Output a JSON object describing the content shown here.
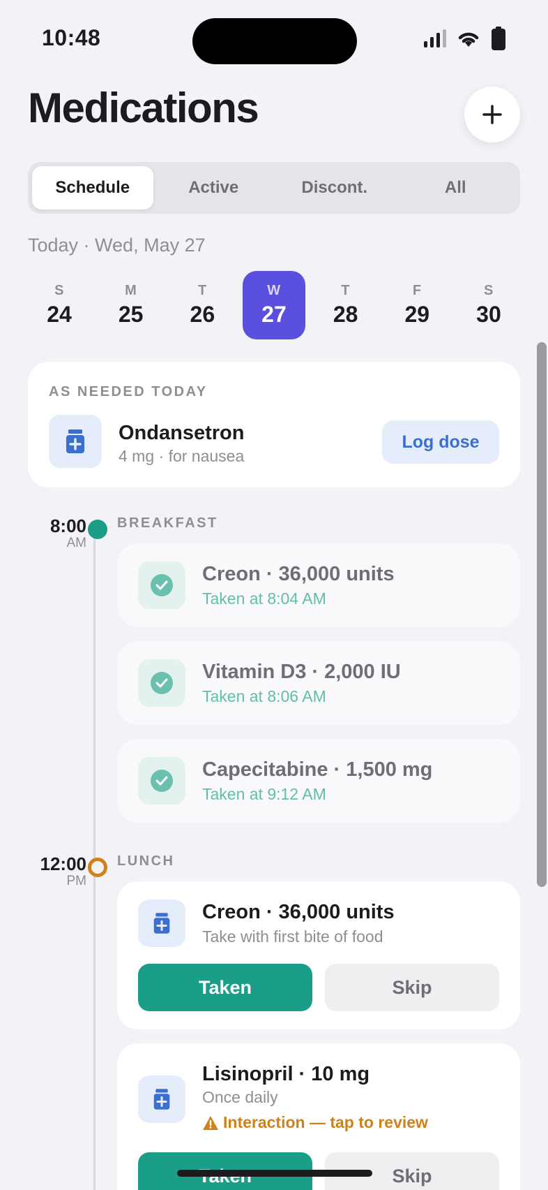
{
  "status_bar": {
    "time": "10:48"
  },
  "header": {
    "title": "Medications",
    "add_icon": "plus-icon"
  },
  "tabs": [
    {
      "label": "Schedule",
      "active": true
    },
    {
      "label": "Active",
      "active": false
    },
    {
      "label": "Discont.",
      "active": false
    },
    {
      "label": "All",
      "active": false
    }
  ],
  "today_label": "Today · Wed, May 27",
  "week": [
    {
      "letter": "S",
      "num": "24"
    },
    {
      "letter": "M",
      "num": "25"
    },
    {
      "letter": "T",
      "num": "26"
    },
    {
      "letter": "W",
      "num": "27",
      "selected": true
    },
    {
      "letter": "T",
      "num": "28"
    },
    {
      "letter": "F",
      "num": "29"
    },
    {
      "letter": "S",
      "num": "30"
    }
  ],
  "as_needed": {
    "caption": "AS NEEDED TODAY",
    "name": "Ondansetron",
    "detail": "4 mg · for nausea",
    "action": "Log dose"
  },
  "breakfast": {
    "time": "8:00",
    "ampm": "AM",
    "caption": "BREAKFAST",
    "doses": [
      {
        "name": "Creon · 36,000 units",
        "status": "Taken at 8:04 AM"
      },
      {
        "name": "Vitamin D3 · 2,000 IU",
        "status": "Taken at 8:06 AM"
      },
      {
        "name": "Capecitabine · 1,500 mg",
        "status": "Taken at 9:12 AM"
      }
    ]
  },
  "lunch": {
    "time": "12:00",
    "ampm": "PM",
    "caption": "LUNCH",
    "doses": [
      {
        "name": "Creon · 36,000 units",
        "instruction": "Take with first bite of food",
        "taken_label": "Taken",
        "skip_label": "Skip"
      },
      {
        "name": "Lisinopril · 10 mg",
        "instruction": "Once daily",
        "warning": "Interaction — tap to review",
        "taken_label": "Taken",
        "skip_label": "Skip"
      }
    ]
  },
  "colors": {
    "accent": "#5b4fe0",
    "taken_green": "#1a9e88",
    "warning": "#d0821a",
    "pill_blue": "#3a6fd0"
  }
}
